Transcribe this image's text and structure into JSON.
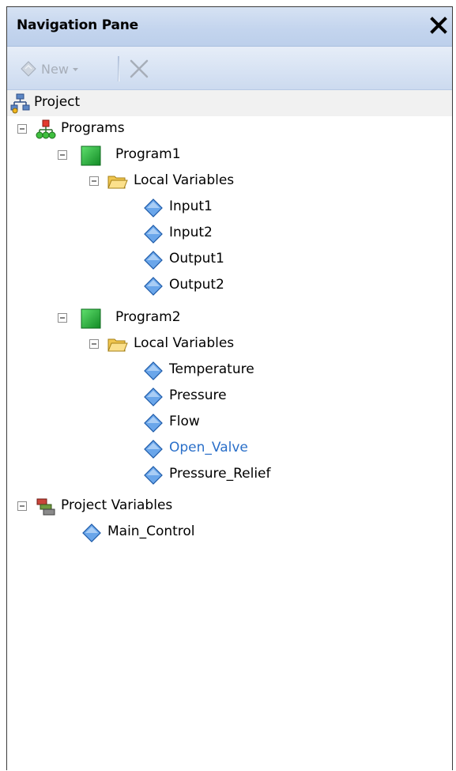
{
  "pane": {
    "title": "Navigation Pane"
  },
  "toolbar": {
    "new_label": "New"
  },
  "tree": {
    "project": {
      "label": "Project"
    },
    "programs": {
      "label": "Programs",
      "items": [
        {
          "label": "Program1",
          "local_variables_label": "Local Variables",
          "variables": [
            "Input1",
            "Input2",
            "Output1",
            "Output2"
          ]
        },
        {
          "label": "Program2",
          "local_variables_label": "Local Variables",
          "variables": [
            "Temperature",
            "Pressure",
            "Flow",
            "Open_Valve",
            "Pressure_Relief"
          ]
        }
      ]
    },
    "project_variables": {
      "label": "Project Variables",
      "variables": [
        "Main_Control"
      ]
    },
    "highlighted_item": "Open_Valve"
  },
  "colors": {
    "title_bar": "#c9d8ee",
    "toolbar": "#d9e4f4",
    "highlight_text": "#2a6fc9",
    "program_icon": "#1fa83a",
    "variable_icon": "#4c8fe0",
    "folder_icon": "#f5c94a"
  },
  "icons": {
    "close": "close-icon",
    "new": "new-item-icon",
    "delete": "delete-icon",
    "project": "project-network-icon",
    "programs": "programs-tree-icon",
    "program": "program-square-icon",
    "folder": "folder-open-icon",
    "variable": "variable-diamond-icon",
    "project_variables": "project-variables-icon",
    "collapse": "collapse-minus-icon"
  }
}
